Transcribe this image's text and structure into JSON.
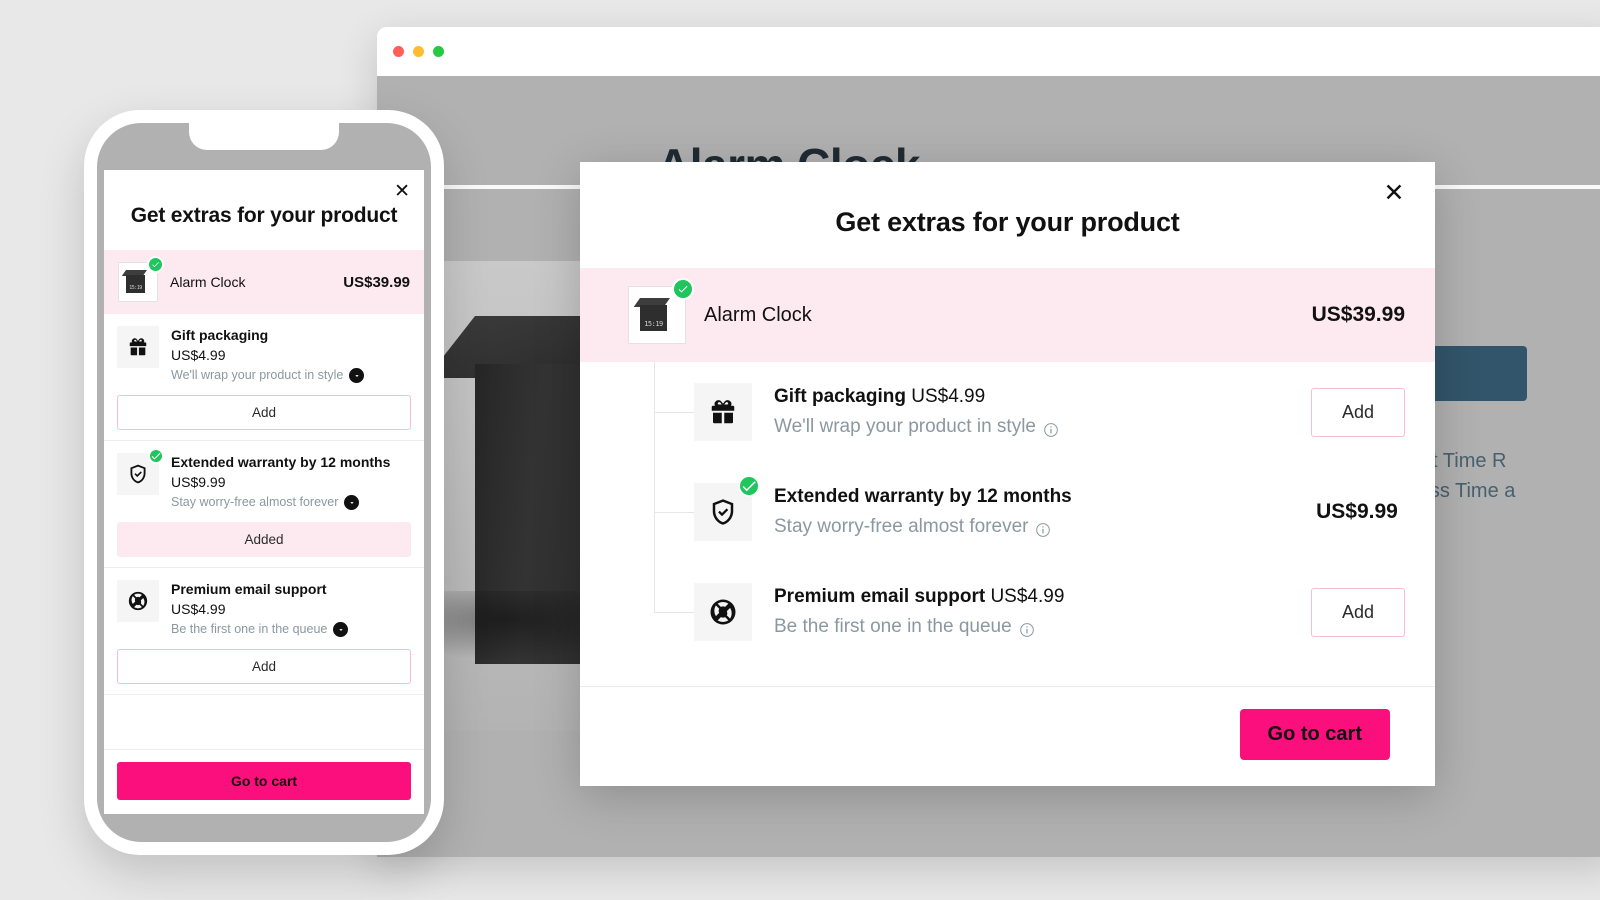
{
  "background_page": {
    "hero_title": "Alarm Clock",
    "cta_button_label": "",
    "copy_line1": "e print Time R",
    "copy_line2": "usiness Time a",
    "product_image_alt": "black-cube-alarm-clock",
    "accent_color": "#32556b"
  },
  "browser_chrome": {
    "traffic_lights": [
      "close-red",
      "minimize-yellow",
      "maximize-green"
    ],
    "colors": {
      "red": "#ff5f57",
      "yellow": "#febc2e",
      "green": "#28c840"
    }
  },
  "modal": {
    "title": "Get extras for your product",
    "close_label": "✕",
    "main_product": {
      "name": "Alarm Clock",
      "price": "US$39.99",
      "thumb_time": "15:19",
      "selected": true
    },
    "addons": [
      {
        "icon": "gift-icon",
        "name": "Gift packaging",
        "price": "US$4.99",
        "description": "We'll wrap your product in style",
        "action_label": "Add",
        "added": false
      },
      {
        "icon": "shield-check-icon",
        "name": "Extended warranty by 12 months",
        "price": "US$9.99",
        "description": "Stay worry-free almost forever",
        "action_label": "Added",
        "added": true
      },
      {
        "icon": "lifebuoy-icon",
        "name": "Premium email support",
        "price": "US$4.99",
        "description": "Be the first one in the queue",
        "action_label": "Add",
        "added": false
      }
    ],
    "footer": {
      "cart_label": "Go to cart"
    }
  },
  "colors": {
    "brand_pink": "#fb0f7d",
    "highlight_pink": "#fdeaf1",
    "border_pink": "#f6bdd4",
    "check_green": "#21c55d",
    "muted_text": "#8b98a1",
    "page_bg": "#e8e8e8"
  }
}
